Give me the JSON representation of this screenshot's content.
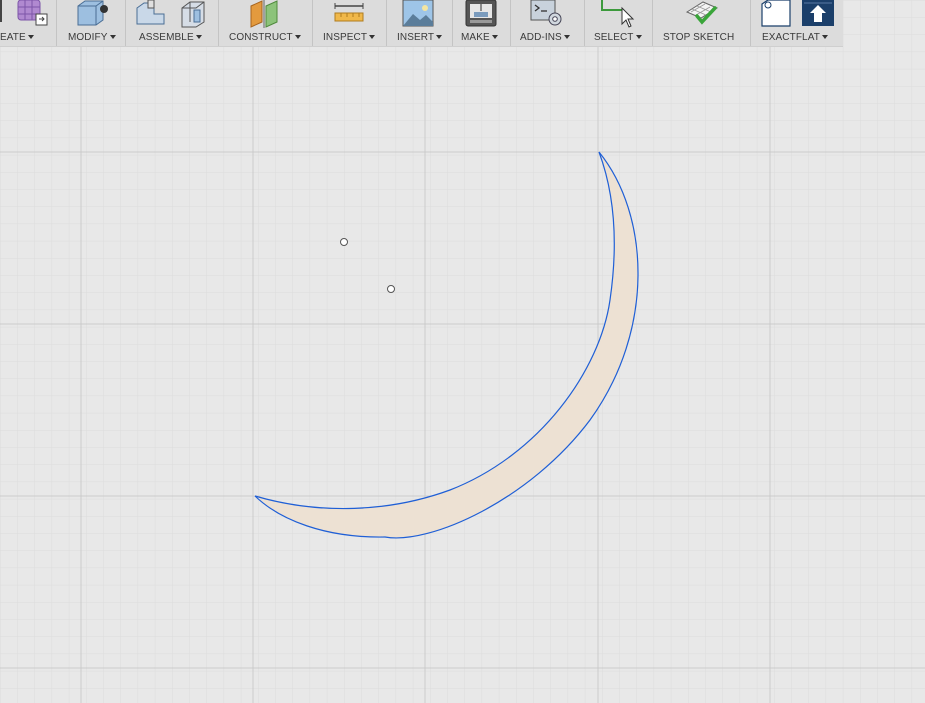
{
  "toolbar": {
    "groups": [
      {
        "label": "EATE",
        "icon": "create-grid-icon"
      },
      {
        "label": "MODIFY",
        "icon": "modify-press-pull-icon"
      },
      {
        "label": "ASSEMBLE",
        "icon": "assemble-joint-icon"
      },
      {
        "label": "CONSTRUCT",
        "icon": "construct-plane-icon"
      },
      {
        "label": "INSPECT",
        "icon": "inspect-measure-icon"
      },
      {
        "label": "INSERT",
        "icon": "insert-image-icon"
      },
      {
        "label": "MAKE",
        "icon": "make-3d-print-icon"
      },
      {
        "label": "ADD-INS",
        "icon": "add-ins-script-icon"
      },
      {
        "label": "SELECT",
        "icon": "select-cursor-icon"
      },
      {
        "label": "STOP SKETCH",
        "icon": "stop-sketch-checkmark-icon"
      },
      {
        "label": "EXACTFLAT",
        "icon": "exactflat-icon"
      }
    ]
  },
  "colors": {
    "canvas_background": "#e8e8e8",
    "grid_major": "#cfcfcf",
    "grid_minor": "#dedede",
    "sketch_curve": "#1f5fd6",
    "profile_fill": "#ede1d3",
    "toolbar_background": "#dcdcdc"
  }
}
